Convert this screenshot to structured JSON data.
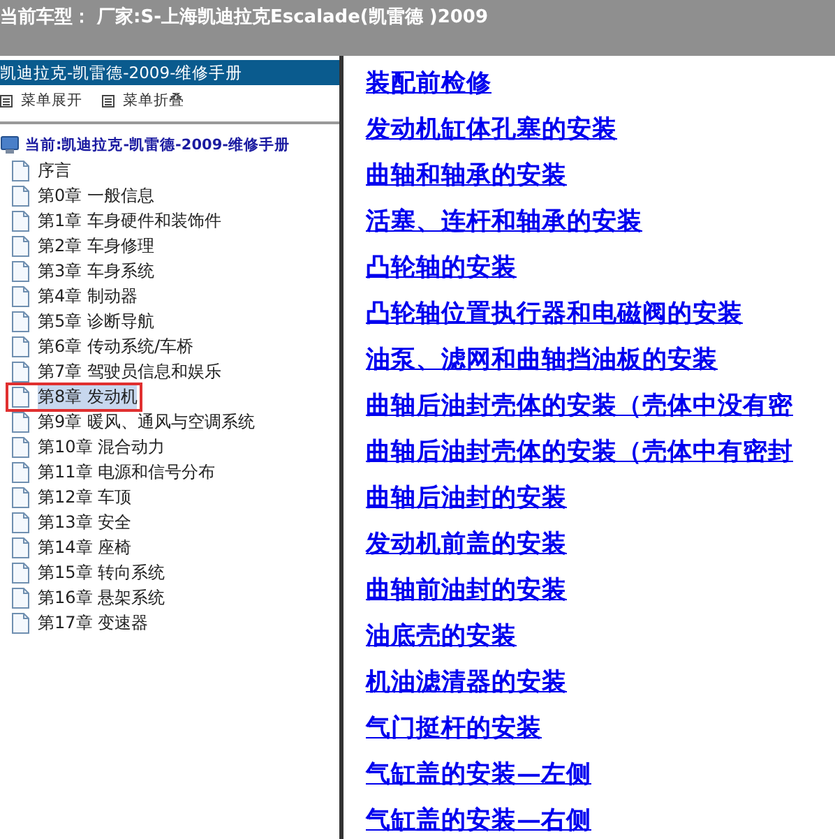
{
  "window": {
    "title": "当前车型： 厂家:S-上海凯迪拉克Escalade(凯雷德 )2009"
  },
  "sidebar": {
    "header": "凯迪拉克-凯雷德-2009-维修手册",
    "toolbar": [
      "菜单展开",
      "菜单折叠"
    ],
    "tree": {
      "label": "当前:凯迪拉克-凯雷德-2009-维修手册",
      "children": [
        {
          "label": "序言",
          "selected": false
        },
        {
          "label": "第0章 一般信息",
          "selected": false
        },
        {
          "label": "第1章 车身硬件和装饰件",
          "selected": false
        },
        {
          "label": "第2章 车身修理",
          "selected": false
        },
        {
          "label": "第3章 车身系统",
          "selected": false
        },
        {
          "label": "第4章 制动器",
          "selected": false
        },
        {
          "label": "第5章 诊断导航",
          "selected": false
        },
        {
          "label": "第6章 传动系统/车桥",
          "selected": false
        },
        {
          "label": "第7章 驾驶员信息和娱乐",
          "selected": false
        },
        {
          "label": "第8章 发动机",
          "selected": true
        },
        {
          "label": "第9章 暖风、通风与空调系统",
          "selected": false
        },
        {
          "label": "第10章 混合动力",
          "selected": false
        },
        {
          "label": "第11章 电源和信号分布",
          "selected": false
        },
        {
          "label": "第12章 车顶",
          "selected": false
        },
        {
          "label": "第13章 安全",
          "selected": false
        },
        {
          "label": "第14章 座椅",
          "selected": false
        },
        {
          "label": "第15章 转向系统",
          "selected": false
        },
        {
          "label": "第16章 悬架系统",
          "selected": false
        },
        {
          "label": "第17章 变速器",
          "selected": false
        }
      ]
    }
  },
  "links": [
    "装配前检修",
    "发动机缸体孔塞的安装",
    "曲轴和轴承的安装",
    "活塞、连杆和轴承的安装",
    "凸轮轴的安装",
    "凸轮轴位置执行器和电磁阀的安装",
    "油泵、滤网和曲轴挡油板的安装",
    "曲轴后油封壳体的安装（壳体中没有密",
    "曲轴后油封壳体的安装（壳体中有密封",
    "曲轴后油封的安装",
    "发动机前盖的安装",
    "曲轴前油封的安装",
    "油底壳的安装",
    "机油滤清器的安装",
    "气门挺杆的安装",
    "气缸盖的安装—左侧",
    "气缸盖的安装—右侧"
  ]
}
